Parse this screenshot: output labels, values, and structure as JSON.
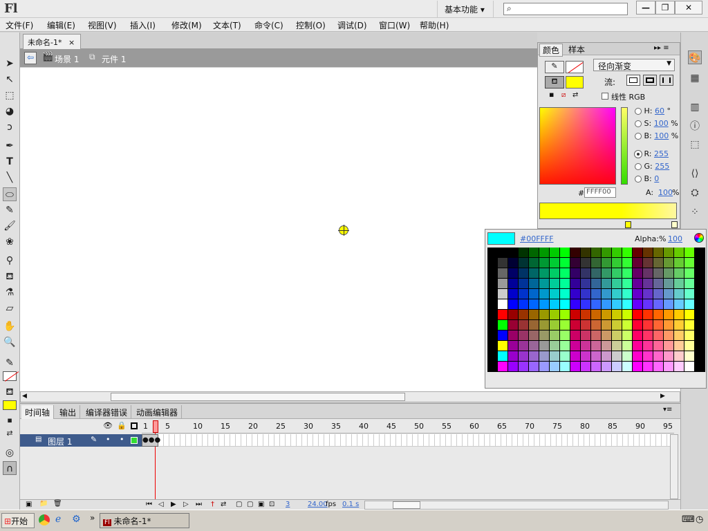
{
  "app": {
    "logo": "Fl",
    "workspace": "基本功能 ▾"
  },
  "menu": [
    "文件(F)",
    "编辑(E)",
    "视图(V)",
    "插入(I)",
    "修改(M)",
    "文本(T)",
    "命令(C)",
    "控制(O)",
    "调试(D)",
    "窗口(W)",
    "帮助(H)"
  ],
  "window_buttons": [
    "—",
    "❐",
    "✕"
  ],
  "doc": {
    "tab": "未命名-1*",
    "scene": "场景 1",
    "symbol": "元件 1"
  },
  "color_panel": {
    "tabs": [
      "颜色",
      "样本"
    ],
    "type": "径向渐变",
    "flow": "流:",
    "linear_rgb": "线性 RGB",
    "hsb": [
      {
        "k": "H:",
        "v": "60",
        "u": "°"
      },
      {
        "k": "S:",
        "v": "100",
        "u": "%"
      },
      {
        "k": "B:",
        "v": "100",
        "u": "%"
      }
    ],
    "rgb": [
      {
        "k": "R:",
        "v": "255"
      },
      {
        "k": "G:",
        "v": "255"
      },
      {
        "k": "B:",
        "v": "0"
      }
    ],
    "hex_label": "#",
    "hex": "FFFF00",
    "alpha_label": "A:",
    "alpha": "100",
    "alpha_unit": "%",
    "fill_color": "#ffff00"
  },
  "swatch_popup": {
    "hex": "#00FFFF",
    "alpha_label": "Alpha:%",
    "alpha": "100",
    "preview": "#00ffff"
  },
  "timeline": {
    "tabs": [
      "时间轴",
      "输出",
      "编译器错误",
      "动画编辑器"
    ],
    "layer": "图层 1",
    "frame_numbers": [
      "1",
      "5",
      "10",
      "15",
      "20",
      "25",
      "30",
      "35",
      "40",
      "45",
      "50",
      "55",
      "60",
      "65",
      "70",
      "75",
      "80",
      "85",
      "90",
      "95"
    ],
    "current_frame": "3",
    "fps": "24.00",
    "fps_unit": "fps",
    "time": "0.1 s"
  },
  "taskbar": {
    "start": "开始",
    "window": "未命名-1*"
  }
}
